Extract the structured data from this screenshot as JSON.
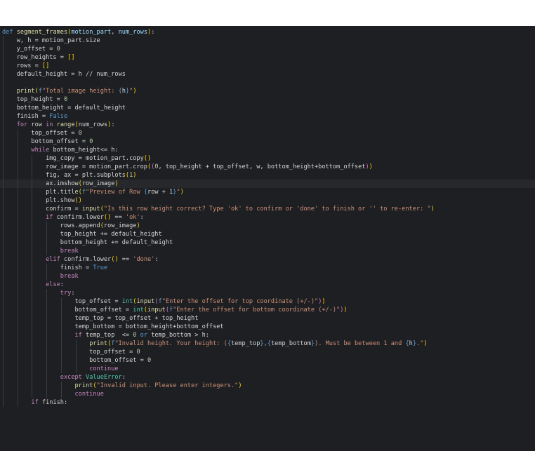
{
  "editor": {
    "language": "python",
    "theme_colors": {
      "background": "#1e1f22",
      "keyword": "#569cd6",
      "control": "#c586c0",
      "function": "#dcdcaa",
      "string": "#ce9178",
      "number": "#b5cea8",
      "class": "#4ec9b0"
    },
    "current_line": 18,
    "lines": [
      [
        {
          "t": "kw",
          "v": "def "
        },
        {
          "t": "fn",
          "v": "segment_frames"
        },
        {
          "t": "br1",
          "v": "("
        },
        {
          "t": "var",
          "v": "motion_part"
        },
        {
          "t": "op",
          "v": ", "
        },
        {
          "t": "var",
          "v": "num_rows"
        },
        {
          "t": "br1",
          "v": ")"
        },
        {
          "t": "op",
          "v": ":"
        }
      ],
      [
        {
          "t": "op",
          "v": "    w, h = motion_part.size"
        }
      ],
      [
        {
          "t": "op",
          "v": "    y_offset = "
        },
        {
          "t": "num",
          "v": "0"
        }
      ],
      [
        {
          "t": "op",
          "v": "    row_heights = "
        },
        {
          "t": "br1",
          "v": "[]"
        }
      ],
      [
        {
          "t": "op",
          "v": "    rows = "
        },
        {
          "t": "br1",
          "v": "[]"
        }
      ],
      [
        {
          "t": "op",
          "v": "    default_height = h // num_rows"
        }
      ],
      [],
      [
        {
          "t": "op",
          "v": "    "
        },
        {
          "t": "fn",
          "v": "print"
        },
        {
          "t": "br1",
          "v": "("
        },
        {
          "t": "kw",
          "v": "f"
        },
        {
          "t": "str",
          "v": "\"Total image height: "
        },
        {
          "t": "kw",
          "v": "{"
        },
        {
          "t": "op",
          "v": "h"
        },
        {
          "t": "kw",
          "v": "}"
        },
        {
          "t": "str",
          "v": "\""
        },
        {
          "t": "br1",
          "v": ")"
        }
      ],
      [
        {
          "t": "op",
          "v": "    top_height = "
        },
        {
          "t": "num",
          "v": "0"
        }
      ],
      [
        {
          "t": "op",
          "v": "    bottom_height = default_height"
        }
      ],
      [
        {
          "t": "op",
          "v": "    finish = "
        },
        {
          "t": "kw",
          "v": "False"
        }
      ],
      [
        {
          "t": "op",
          "v": "    "
        },
        {
          "t": "ctl",
          "v": "for"
        },
        {
          "t": "op",
          "v": " row "
        },
        {
          "t": "ctl",
          "v": "in"
        },
        {
          "t": "op",
          "v": " "
        },
        {
          "t": "fn",
          "v": "range"
        },
        {
          "t": "br1",
          "v": "("
        },
        {
          "t": "op",
          "v": "num_rows"
        },
        {
          "t": "br1",
          "v": ")"
        },
        {
          "t": "op",
          "v": ":"
        }
      ],
      [
        {
          "t": "op",
          "v": "        top_offset = "
        },
        {
          "t": "num",
          "v": "0"
        }
      ],
      [
        {
          "t": "op",
          "v": "        bottom_offset = "
        },
        {
          "t": "num",
          "v": "0"
        }
      ],
      [
        {
          "t": "op",
          "v": "        "
        },
        {
          "t": "ctl",
          "v": "while"
        },
        {
          "t": "op",
          "v": " bottom_height<= h:"
        }
      ],
      [
        {
          "t": "op",
          "v": "            img_copy = motion_part.copy"
        },
        {
          "t": "br1",
          "v": "()"
        }
      ],
      [
        {
          "t": "op",
          "v": "            row_image = motion_part.crop"
        },
        {
          "t": "br1",
          "v": "("
        },
        {
          "t": "br2",
          "v": "("
        },
        {
          "t": "num",
          "v": "0"
        },
        {
          "t": "op",
          "v": ", top_height + top_offset, w, bottom_height+bottom_offset"
        },
        {
          "t": "br2",
          "v": ")"
        },
        {
          "t": "br1",
          "v": ")"
        }
      ],
      [
        {
          "t": "op",
          "v": "            fig, ax = plt.subplots"
        },
        {
          "t": "br1",
          "v": "("
        },
        {
          "t": "num",
          "v": "1"
        },
        {
          "t": "br1",
          "v": ")"
        }
      ],
      [
        {
          "t": "op",
          "v": "            ax.imshow"
        },
        {
          "t": "br1",
          "v": "("
        },
        {
          "t": "op",
          "v": "row_image"
        },
        {
          "t": "br1",
          "v": ")"
        }
      ],
      [
        {
          "t": "op",
          "v": "            plt.title"
        },
        {
          "t": "br1",
          "v": "("
        },
        {
          "t": "kw",
          "v": "f"
        },
        {
          "t": "str",
          "v": "\"Preview of Row "
        },
        {
          "t": "kw",
          "v": "{"
        },
        {
          "t": "op",
          "v": "row + 1"
        },
        {
          "t": "kw",
          "v": "}"
        },
        {
          "t": "str",
          "v": "\""
        },
        {
          "t": "br1",
          "v": ")"
        }
      ],
      [
        {
          "t": "op",
          "v": "            plt.show"
        },
        {
          "t": "br1",
          "v": "()"
        }
      ],
      [
        {
          "t": "op",
          "v": "            confirm = "
        },
        {
          "t": "fn",
          "v": "input"
        },
        {
          "t": "br1",
          "v": "("
        },
        {
          "t": "str",
          "v": "\"Is this row height correct? Type 'ok' to confirm or 'done' to finish or '' to re-enter: \""
        },
        {
          "t": "br1",
          "v": ")"
        }
      ],
      [
        {
          "t": "op",
          "v": "            "
        },
        {
          "t": "ctl",
          "v": "if"
        },
        {
          "t": "op",
          "v": " confirm.lower"
        },
        {
          "t": "br1",
          "v": "()"
        },
        {
          "t": "op",
          "v": " == "
        },
        {
          "t": "str",
          "v": "'ok'"
        },
        {
          "t": "op",
          "v": ":"
        }
      ],
      [
        {
          "t": "op",
          "v": "                rows.append"
        },
        {
          "t": "br1",
          "v": "("
        },
        {
          "t": "op",
          "v": "row_image"
        },
        {
          "t": "br1",
          "v": ")"
        }
      ],
      [
        {
          "t": "op",
          "v": "                top_height += default_height"
        }
      ],
      [
        {
          "t": "op",
          "v": "                bottom_height += default_height"
        }
      ],
      [
        {
          "t": "op",
          "v": "                "
        },
        {
          "t": "ctl",
          "v": "break"
        }
      ],
      [
        {
          "t": "op",
          "v": "            "
        },
        {
          "t": "ctl",
          "v": "elif"
        },
        {
          "t": "op",
          "v": " confirm.lower"
        },
        {
          "t": "br1",
          "v": "()"
        },
        {
          "t": "op",
          "v": " == "
        },
        {
          "t": "str",
          "v": "'done'"
        },
        {
          "t": "op",
          "v": ":"
        }
      ],
      [
        {
          "t": "op",
          "v": "                finish = "
        },
        {
          "t": "kw",
          "v": "True"
        }
      ],
      [
        {
          "t": "op",
          "v": "                "
        },
        {
          "t": "ctl",
          "v": "break"
        }
      ],
      [
        {
          "t": "op",
          "v": "            "
        },
        {
          "t": "ctl",
          "v": "else"
        },
        {
          "t": "op",
          "v": ":"
        }
      ],
      [
        {
          "t": "op",
          "v": "                "
        },
        {
          "t": "ctl",
          "v": "try"
        },
        {
          "t": "op",
          "v": ":"
        }
      ],
      [
        {
          "t": "op",
          "v": "                    top_offset = "
        },
        {
          "t": "cls",
          "v": "int"
        },
        {
          "t": "br1",
          "v": "("
        },
        {
          "t": "fn",
          "v": "input"
        },
        {
          "t": "br2",
          "v": "("
        },
        {
          "t": "kw",
          "v": "f"
        },
        {
          "t": "str",
          "v": "\"Enter the offset for top coordinate (+/-)\""
        },
        {
          "t": "br2",
          "v": ")"
        },
        {
          "t": "br1",
          "v": ")"
        }
      ],
      [
        {
          "t": "op",
          "v": "                    bottom_offset = "
        },
        {
          "t": "cls",
          "v": "int"
        },
        {
          "t": "br1",
          "v": "("
        },
        {
          "t": "fn",
          "v": "input"
        },
        {
          "t": "br2",
          "v": "("
        },
        {
          "t": "kw",
          "v": "f"
        },
        {
          "t": "str",
          "v": "\"Enter the offset for bottom coordinate (+/-)\""
        },
        {
          "t": "br2",
          "v": ")"
        },
        {
          "t": "br1",
          "v": ")"
        }
      ],
      [
        {
          "t": "op",
          "v": "                    temp_top = top_offset + top_height"
        }
      ],
      [
        {
          "t": "op",
          "v": "                    temp_bottom = bottom_height+bottom_offset"
        }
      ],
      [
        {
          "t": "op",
          "v": "                    "
        },
        {
          "t": "ctl",
          "v": "if"
        },
        {
          "t": "op",
          "v": " temp_top  <= "
        },
        {
          "t": "num",
          "v": "0"
        },
        {
          "t": "op",
          "v": " "
        },
        {
          "t": "kw",
          "v": "or"
        },
        {
          "t": "op",
          "v": " temp_bottom > h:"
        }
      ],
      [
        {
          "t": "op",
          "v": "                        "
        },
        {
          "t": "fn",
          "v": "print"
        },
        {
          "t": "br1",
          "v": "("
        },
        {
          "t": "kw",
          "v": "f"
        },
        {
          "t": "str",
          "v": "\"Invalid height. Your height: ("
        },
        {
          "t": "kw",
          "v": "{"
        },
        {
          "t": "op",
          "v": "temp_top"
        },
        {
          "t": "kw",
          "v": "}"
        },
        {
          "t": "str",
          "v": ","
        },
        {
          "t": "kw",
          "v": "{"
        },
        {
          "t": "op",
          "v": "temp_bottom"
        },
        {
          "t": "kw",
          "v": "}"
        },
        {
          "t": "str",
          "v": "). Must be between 1 and "
        },
        {
          "t": "kw",
          "v": "{"
        },
        {
          "t": "op",
          "v": "h"
        },
        {
          "t": "kw",
          "v": "}"
        },
        {
          "t": "str",
          "v": ".\""
        },
        {
          "t": "br1",
          "v": ")"
        }
      ],
      [
        {
          "t": "op",
          "v": "                        top_offset = "
        },
        {
          "t": "num",
          "v": "0"
        }
      ],
      [
        {
          "t": "op",
          "v": "                        bottom_offset = "
        },
        {
          "t": "num",
          "v": "0"
        }
      ],
      [
        {
          "t": "op",
          "v": "                        "
        },
        {
          "t": "ctl",
          "v": "continue"
        }
      ],
      [
        {
          "t": "op",
          "v": "                "
        },
        {
          "t": "ctl",
          "v": "except"
        },
        {
          "t": "op",
          "v": " "
        },
        {
          "t": "cls",
          "v": "ValueError"
        },
        {
          "t": "op",
          "v": ":"
        }
      ],
      [
        {
          "t": "op",
          "v": "                    "
        },
        {
          "t": "fn",
          "v": "print"
        },
        {
          "t": "br1",
          "v": "("
        },
        {
          "t": "str",
          "v": "\"Invalid input. Please enter integers.\""
        },
        {
          "t": "br1",
          "v": ")"
        }
      ],
      [
        {
          "t": "op",
          "v": "                    "
        },
        {
          "t": "ctl",
          "v": "continue"
        }
      ],
      [
        {
          "t": "op",
          "v": "        "
        },
        {
          "t": "ctl",
          "v": "if"
        },
        {
          "t": "op",
          "v": " finish:"
        }
      ]
    ]
  }
}
